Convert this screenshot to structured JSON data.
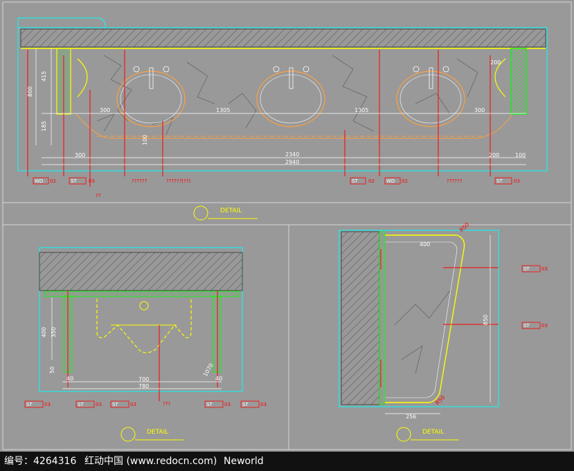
{
  "colors": {
    "background": "#999999",
    "frame": "#d8d8d8",
    "cyan": "#00ffff",
    "yellow": "#ffff00",
    "red": "#ff0000",
    "green": "#00ff00",
    "orange": "#ffa040",
    "white": "#ffffff",
    "hatch": "#555555",
    "marble": "#6e6e6e",
    "watermark_bg": "#111111"
  },
  "main_elevation": {
    "dimensions": {
      "left_height_total": "800",
      "left_height_upper": "415",
      "left_height_lower": "185",
      "left_offset": "300",
      "right_offset": "300",
      "gap_left": "1305",
      "gap_right": "1305",
      "bottom_left": "300",
      "inner_span": "2340",
      "overall_span": "2940",
      "right_bottom_a": "200",
      "right_bottom_b": "100",
      "right_top": "200",
      "drop": "100"
    },
    "tags": [
      {
        "code": "WD",
        "num": "02",
        "name": "icon-wd02-tag"
      },
      {
        "code": "ST",
        "num": "03",
        "name": "icon-st03-tag"
      },
      {
        "code": "ST",
        "num": "02",
        "name": "icon-st02-tag"
      },
      {
        "code": "WD",
        "num": "02",
        "name": "icon-wd02-tag"
      },
      {
        "code": "ST",
        "num": "03",
        "name": "icon-st03-tag"
      }
    ],
    "notes": [
      "??",
      "??????",
      "??????(??)",
      "??????"
    ],
    "detail_label": "DETAIL"
  },
  "section_left": {
    "dimensions": {
      "height_a": "400",
      "height_b": "350",
      "small_a": "50",
      "small_b": "40",
      "small_c": "40",
      "inner_width": "700",
      "outer_width": "780",
      "right_small": "1070"
    },
    "tags": [
      {
        "code": "ST",
        "num": "03"
      },
      {
        "code": "ST",
        "num": "03"
      },
      {
        "code": "ST",
        "num": "03"
      },
      {
        "code": "ST",
        "num": "03"
      },
      {
        "code": "ST",
        "num": "03"
      }
    ],
    "note": "???",
    "detail_label": "DETAIL"
  },
  "section_right": {
    "dimensions": {
      "top_width": "400",
      "height": "850",
      "bottom_width": "256",
      "radius_top": "R50",
      "radius_bottom": "R50"
    },
    "tags": [
      {
        "code": "ST",
        "num": "03"
      },
      {
        "code": "ST",
        "num": "03"
      }
    ],
    "detail_label": "DETAIL"
  },
  "watermark": {
    "id_label": "编号：4264316",
    "site": "红动中国 (www.redocn.com)",
    "author": "Neworld"
  }
}
